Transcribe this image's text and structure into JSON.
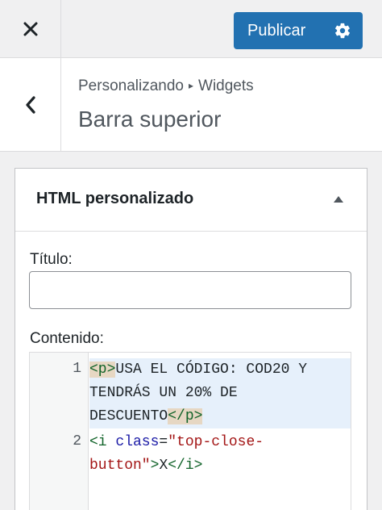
{
  "topbar": {
    "close_icon": "close-icon",
    "publish_label": "Publicar",
    "settings_icon": "gear-icon",
    "accent": "#2271b1"
  },
  "header": {
    "back_icon": "chevron-left-icon",
    "breadcrumb_parent": "Personalizando",
    "breadcrumb_separator": "▸",
    "breadcrumb_current": "Widgets",
    "title": "Barra superior"
  },
  "widget": {
    "title": "HTML personalizado",
    "toggle_icon": "triangle-up-icon",
    "title_label": "Título:",
    "title_value": "",
    "content_label": "Contenido:",
    "code": {
      "line1_number": "1",
      "line2_number": "2",
      "line1_open_tag": "<p>",
      "line1_text_a": "USA EL CÓDIGO: COD20 Y",
      "line1_text_b": "TENDRÁS UN 20% DE",
      "line1_text_c": "DESCUENTO",
      "line1_close_tag": "</p>",
      "line2_tag_open": "<i ",
      "line2_attr": "class",
      "line2_eq": "=",
      "line2_val_a": "\"top-close-",
      "line2_val_b": "button\"",
      "line2_gt": ">",
      "line2_text": "X",
      "line2_close_tag": "</i>"
    }
  }
}
